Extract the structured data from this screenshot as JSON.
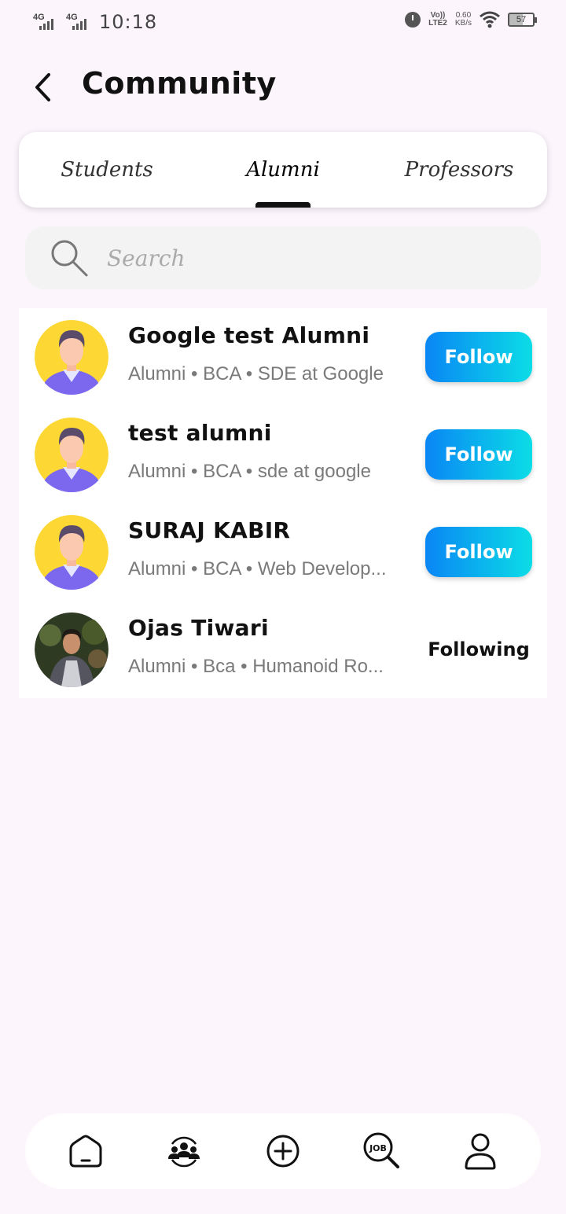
{
  "status_bar": {
    "signal1": "4G",
    "signal2": "4G",
    "time": "10:18",
    "volte_top": "Vo))",
    "volte_bottom": "LTE2",
    "speed_value": "0.60",
    "speed_unit": "KB/s",
    "battery": "57"
  },
  "header": {
    "title": "Community",
    "back_icon": "chevron-left-icon"
  },
  "tabs": [
    {
      "label": "Students",
      "active": false
    },
    {
      "label": "Alumni",
      "active": true
    },
    {
      "label": "Professors",
      "active": false
    }
  ],
  "search": {
    "placeholder": "Search",
    "icon": "search-icon"
  },
  "members": [
    {
      "name": "Google test Alumni",
      "meta": "Alumni • BCA • SDE at Google",
      "action": "Follow",
      "avatar": "default-avatar"
    },
    {
      "name": "test alumni",
      "meta": "Alumni • BCA • sde at google",
      "action": "Follow",
      "avatar": "default-avatar"
    },
    {
      "name": "SURAJ KABIR",
      "meta": "Alumni • BCA • Web Develop...",
      "action": "Follow",
      "avatar": "default-avatar"
    },
    {
      "name": "Ojas Tiwari",
      "meta": "Alumni • Bca • Humanoid Ro...",
      "action": "Following",
      "avatar": "photo-avatar"
    }
  ],
  "bottom_nav": [
    {
      "icon": "home-icon"
    },
    {
      "icon": "community-icon"
    },
    {
      "icon": "add-post-icon"
    },
    {
      "icon": "job-search-icon"
    },
    {
      "icon": "profile-icon"
    }
  ],
  "colors": {
    "background": "#fcf5fc",
    "follow_gradient_start": "#0a86f5",
    "follow_gradient_end": "#0bdde6",
    "avatar_yellow": "#fdd835",
    "avatar_shirt": "#7b68ee"
  }
}
